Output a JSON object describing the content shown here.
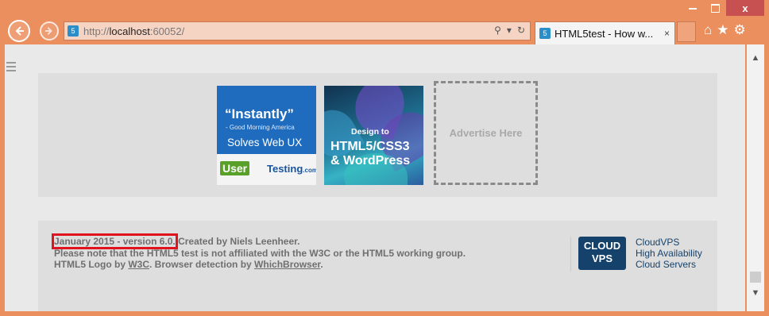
{
  "browser": {
    "close_glyph": "x",
    "address": {
      "proto": "http://",
      "host": "localhost",
      "port": ":60052/"
    },
    "tab": {
      "title": "HTML5test - How w...",
      "close": "×"
    },
    "icons": [
      "home-icon",
      "star-icon",
      "gear-icon"
    ]
  },
  "ads": {
    "ad1": {
      "quote": "“Instantly”",
      "attribution": "- Good Morning America",
      "tagline": "Solves Web UX",
      "brand_a": "User",
      "brand_b": "Testing",
      "brand_tld": ".com"
    },
    "ad2": {
      "pre": "Design to",
      "line1": "HTML5/CSS3",
      "line2": "& WordPress"
    },
    "ad3": {
      "label": "Advertise Here"
    }
  },
  "footer": {
    "version": "January 2015 - version 6.0.",
    "created": " Created by Niels Leenheer.",
    "disclaimer": "Please note that the HTML5 test is not affiliated with the W3C or the HTML5 working group.",
    "logo_prefix": "HTML5 Logo by ",
    "w3c": "W3C",
    "detect_prefix": ". Browser detection by ",
    "whichbrowser": "WhichBrowser",
    "end": ".",
    "sponsor_logo_line1": "CLOUD",
    "sponsor_logo_line2": "VPS",
    "sponsor_name": "CloudVPS",
    "sponsor_line2": "High Availability",
    "sponsor_line3": "Cloud Servers"
  },
  "colors": {
    "chrome": "#ec8f5f",
    "highlight": "#e0141e"
  }
}
